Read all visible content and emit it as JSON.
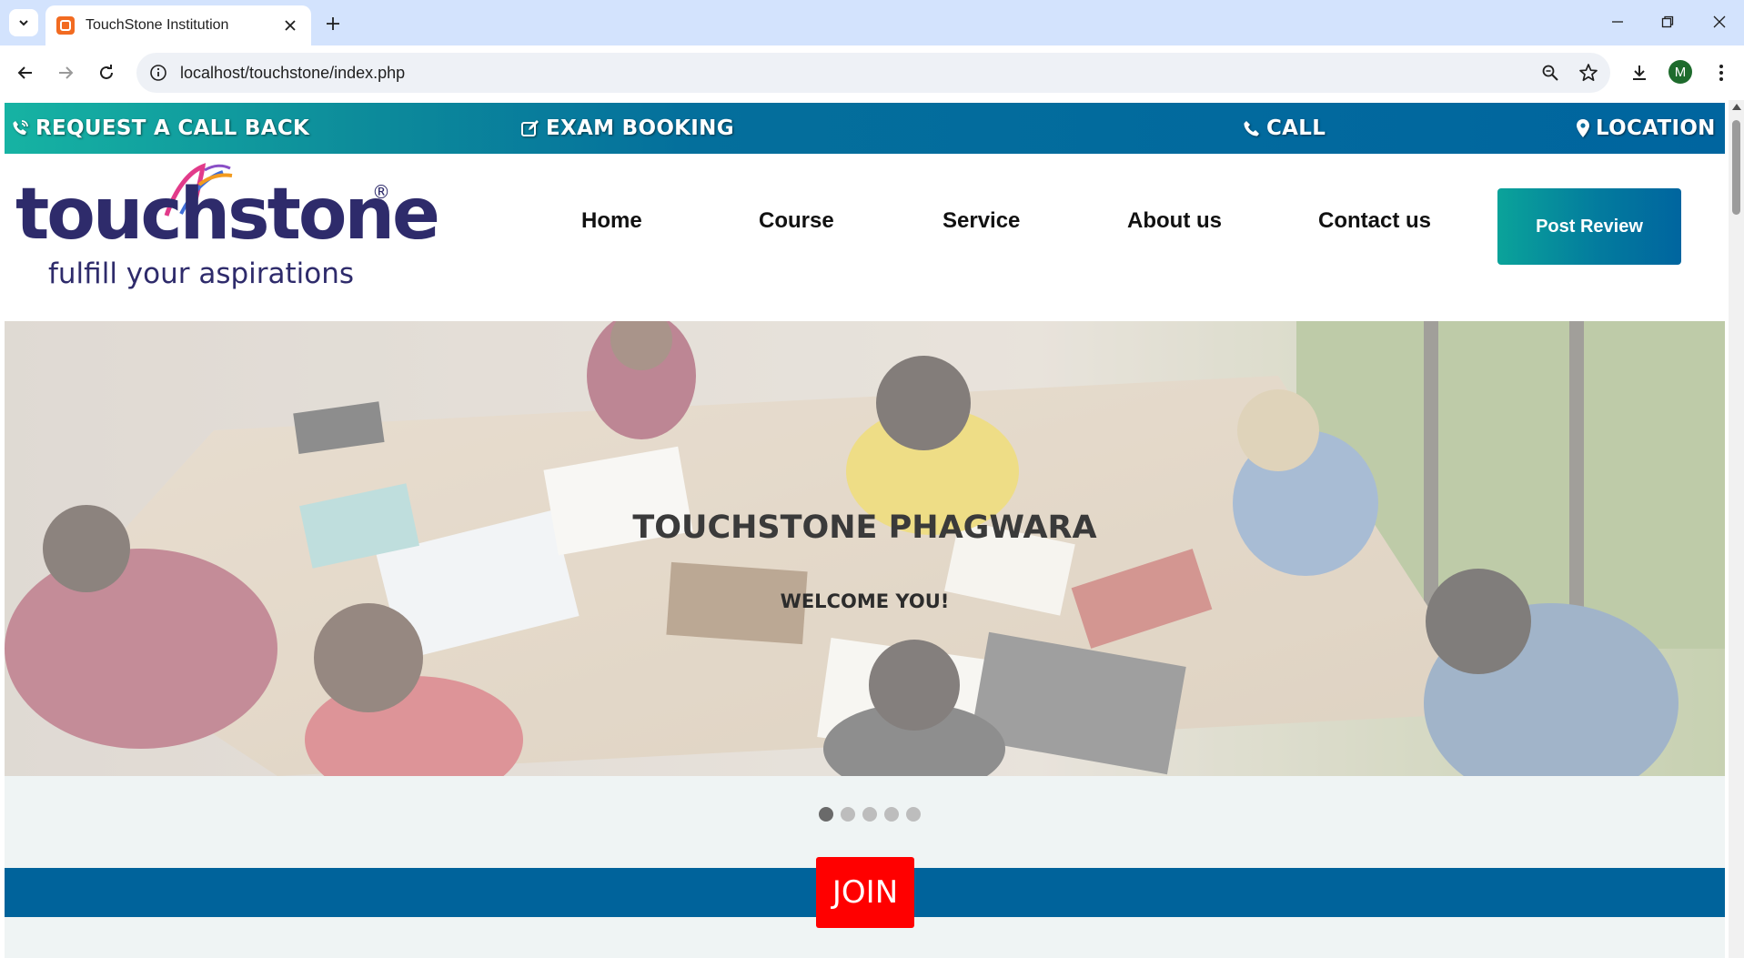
{
  "browser": {
    "tab_title": "TouchStone Institution",
    "url": "localhost/touchstone/index.php",
    "profile_initial": "M"
  },
  "topbar": {
    "request_call_back": "REQUEST A CALL BACK",
    "exam_booking": "EXAM BOOKING",
    "call": "CALL",
    "location": "LOCATION"
  },
  "logo": {
    "wordmark": "touchstone",
    "registered": "®",
    "tagline": "fulfill your aspirations"
  },
  "nav": {
    "items": [
      "Home",
      "Course",
      "Service",
      "About us",
      "Contact us"
    ],
    "post_review": "Post Review"
  },
  "hero": {
    "title": "TOUCHSTONE PHAGWARA",
    "subtitle": "WELCOME YOU!",
    "slide_count": 5,
    "active_slide": 1
  },
  "join": {
    "label": "JOIN"
  },
  "colors": {
    "brand_blue": "#00659f",
    "brand_teal": "#16b3a3",
    "join_red": "#ff0000",
    "logo_navy": "#2e2b6b"
  }
}
